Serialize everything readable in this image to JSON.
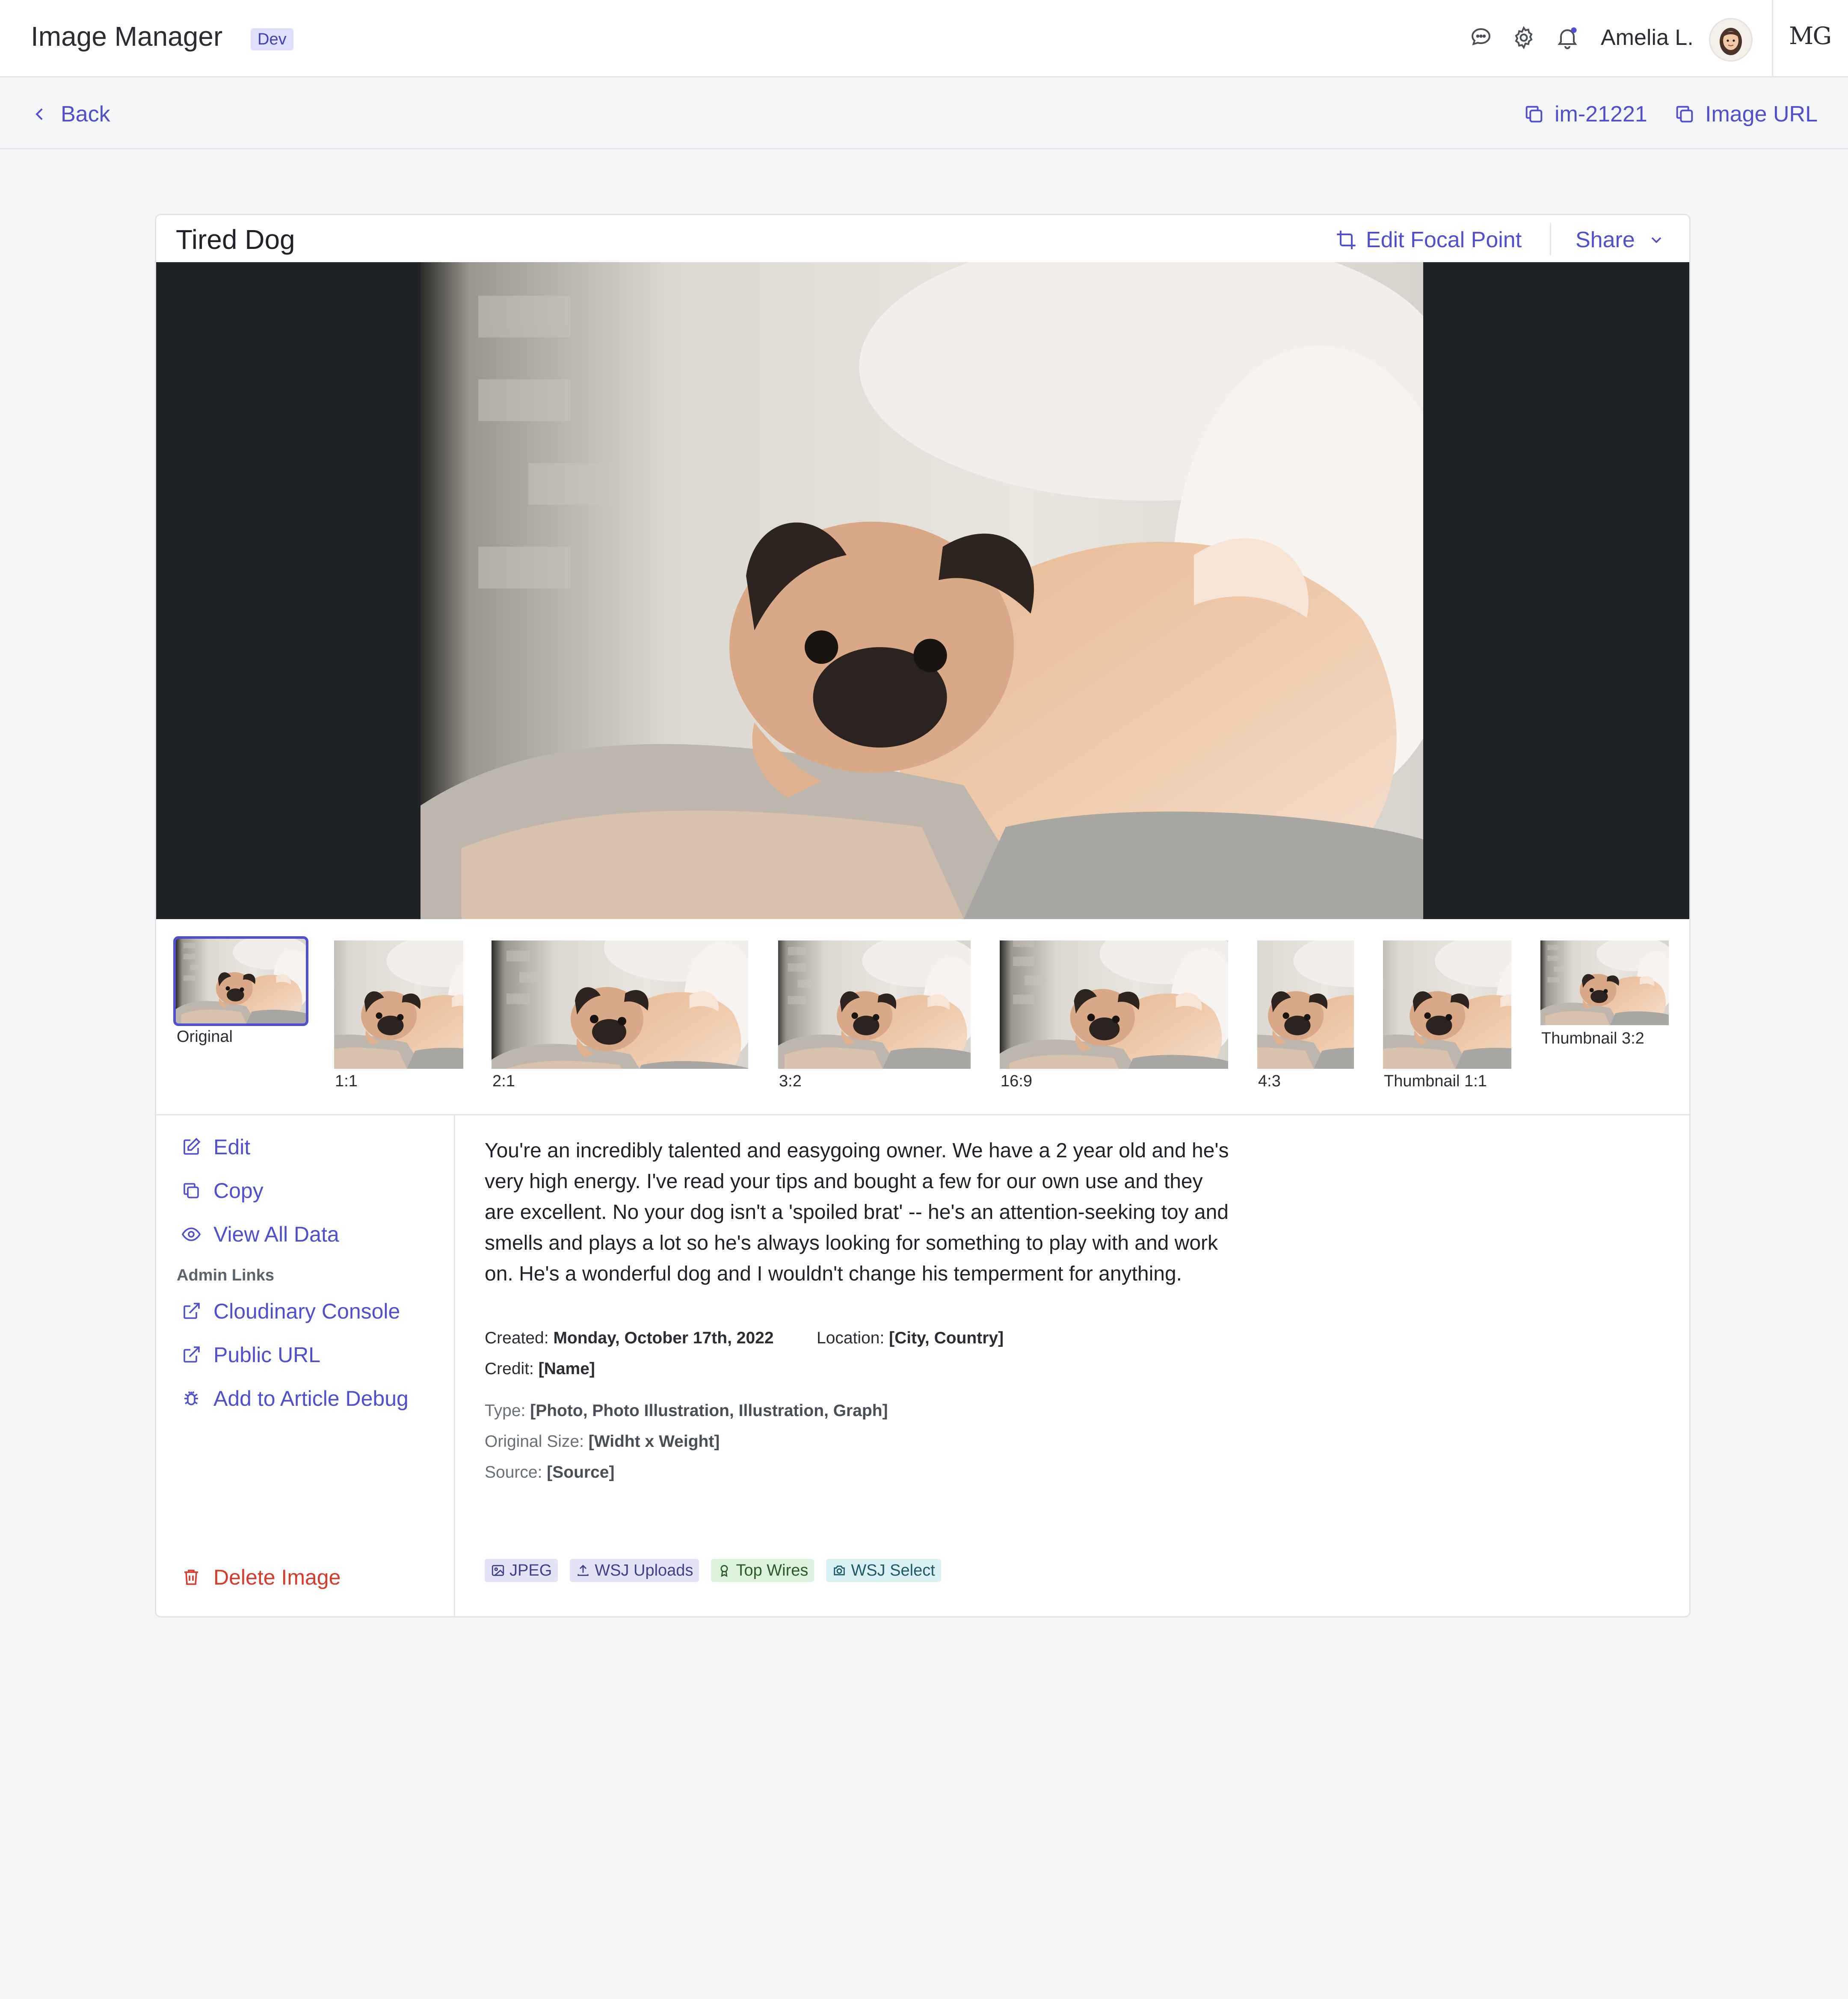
{
  "header": {
    "app_title": "Image Manager",
    "env_badge": "Dev",
    "user_name": "Amelia L.",
    "logo_text": "MG",
    "icons": [
      "chat-icon",
      "gear-icon",
      "bell-icon"
    ]
  },
  "subbar": {
    "back_label": "Back",
    "image_id": "im-21221",
    "image_url_label": "Image URL"
  },
  "card": {
    "title": "Tired Dog",
    "edit_focal_label": "Edit Focal Point",
    "share_label": "Share"
  },
  "crops": [
    {
      "label": "Original",
      "selected": true
    },
    {
      "label": "1:1"
    },
    {
      "label": "2:1"
    },
    {
      "label": "3:2"
    },
    {
      "label": "16:9"
    },
    {
      "label": "4:3"
    },
    {
      "label": "Thumbnail 1:1"
    },
    {
      "label": "Thumbnail 3:2"
    }
  ],
  "actions": {
    "edit": "Edit",
    "copy": "Copy",
    "view_all": "View All Data",
    "admin_label": "Admin Links",
    "cloudinary": "Cloudinary Console",
    "public_url": "Public URL",
    "article_debug": "Add to Article Debug",
    "delete": "Delete Image"
  },
  "details": {
    "description": "You're an incredibly talented and easygoing owner. We have a 2 year old and he's very high energy. I've read your tips and bought a few for our own use and they are excellent. No your dog isn't a 'spoiled brat' -- he's an attention-seeking toy and smells and plays a lot so he's always looking for something to play with and work on. He's a wonderful dog and I wouldn't change his temperment for anything.",
    "created_label": "Created:",
    "created_value": "Monday, October 17th, 2022",
    "location_label": "Location:",
    "location_value": "[City, Country]",
    "credit_label": "Credit:",
    "credit_value": "[Name]",
    "type_label": "Type:",
    "type_value": "[Photo, Photo Illustration, Illustration, Graph]",
    "size_label": "Original Size:",
    "size_value": "[Widht x Weight]",
    "source_label": "Source:",
    "source_value": "[Source]"
  },
  "tags": [
    {
      "label": "JPEG",
      "icon": "image-icon"
    },
    {
      "label": "WSJ Uploads",
      "icon": "upload-icon"
    },
    {
      "label": "Top Wires",
      "icon": "award-icon"
    },
    {
      "label": "WSJ Select",
      "icon": "camera-icon"
    }
  ],
  "colors": {
    "accent": "#4f4fd0",
    "danger": "#d63b2c",
    "viewer_bg": "#1f2327",
    "page_bg": "#f5f6f8"
  }
}
